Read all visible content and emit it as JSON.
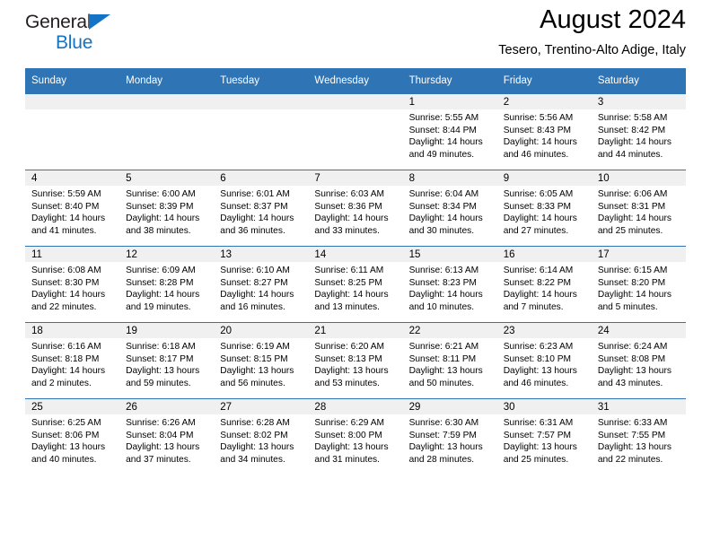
{
  "logo": {
    "name_top": "General",
    "name_bottom": "Blue",
    "triangle_icon": "triangle-icon",
    "accent_color": "#1473c4"
  },
  "header": {
    "month_title": "August 2024",
    "location": "Tesero, Trentino-Alto Adige, Italy"
  },
  "theme": {
    "header_blue": "#2f74b5",
    "daynum_band": "#f0f0f0",
    "text": "#000000"
  },
  "weekday_headers": [
    "Sunday",
    "Monday",
    "Tuesday",
    "Wednesday",
    "Thursday",
    "Friday",
    "Saturday"
  ],
  "weeks": [
    [
      {
        "day": "",
        "sunrise": "",
        "sunset": "",
        "daylight_line1": "",
        "daylight_line2": ""
      },
      {
        "day": "",
        "sunrise": "",
        "sunset": "",
        "daylight_line1": "",
        "daylight_line2": ""
      },
      {
        "day": "",
        "sunrise": "",
        "sunset": "",
        "daylight_line1": "",
        "daylight_line2": ""
      },
      {
        "day": "",
        "sunrise": "",
        "sunset": "",
        "daylight_line1": "",
        "daylight_line2": ""
      },
      {
        "day": "1",
        "sunrise": "Sunrise: 5:55 AM",
        "sunset": "Sunset: 8:44 PM",
        "daylight_line1": "Daylight: 14 hours",
        "daylight_line2": "and 49 minutes."
      },
      {
        "day": "2",
        "sunrise": "Sunrise: 5:56 AM",
        "sunset": "Sunset: 8:43 PM",
        "daylight_line1": "Daylight: 14 hours",
        "daylight_line2": "and 46 minutes."
      },
      {
        "day": "3",
        "sunrise": "Sunrise: 5:58 AM",
        "sunset": "Sunset: 8:42 PM",
        "daylight_line1": "Daylight: 14 hours",
        "daylight_line2": "and 44 minutes."
      }
    ],
    [
      {
        "day": "4",
        "sunrise": "Sunrise: 5:59 AM",
        "sunset": "Sunset: 8:40 PM",
        "daylight_line1": "Daylight: 14 hours",
        "daylight_line2": "and 41 minutes."
      },
      {
        "day": "5",
        "sunrise": "Sunrise: 6:00 AM",
        "sunset": "Sunset: 8:39 PM",
        "daylight_line1": "Daylight: 14 hours",
        "daylight_line2": "and 38 minutes."
      },
      {
        "day": "6",
        "sunrise": "Sunrise: 6:01 AM",
        "sunset": "Sunset: 8:37 PM",
        "daylight_line1": "Daylight: 14 hours",
        "daylight_line2": "and 36 minutes."
      },
      {
        "day": "7",
        "sunrise": "Sunrise: 6:03 AM",
        "sunset": "Sunset: 8:36 PM",
        "daylight_line1": "Daylight: 14 hours",
        "daylight_line2": "and 33 minutes."
      },
      {
        "day": "8",
        "sunrise": "Sunrise: 6:04 AM",
        "sunset": "Sunset: 8:34 PM",
        "daylight_line1": "Daylight: 14 hours",
        "daylight_line2": "and 30 minutes."
      },
      {
        "day": "9",
        "sunrise": "Sunrise: 6:05 AM",
        "sunset": "Sunset: 8:33 PM",
        "daylight_line1": "Daylight: 14 hours",
        "daylight_line2": "and 27 minutes."
      },
      {
        "day": "10",
        "sunrise": "Sunrise: 6:06 AM",
        "sunset": "Sunset: 8:31 PM",
        "daylight_line1": "Daylight: 14 hours",
        "daylight_line2": "and 25 minutes."
      }
    ],
    [
      {
        "day": "11",
        "sunrise": "Sunrise: 6:08 AM",
        "sunset": "Sunset: 8:30 PM",
        "daylight_line1": "Daylight: 14 hours",
        "daylight_line2": "and 22 minutes."
      },
      {
        "day": "12",
        "sunrise": "Sunrise: 6:09 AM",
        "sunset": "Sunset: 8:28 PM",
        "daylight_line1": "Daylight: 14 hours",
        "daylight_line2": "and 19 minutes."
      },
      {
        "day": "13",
        "sunrise": "Sunrise: 6:10 AM",
        "sunset": "Sunset: 8:27 PM",
        "daylight_line1": "Daylight: 14 hours",
        "daylight_line2": "and 16 minutes."
      },
      {
        "day": "14",
        "sunrise": "Sunrise: 6:11 AM",
        "sunset": "Sunset: 8:25 PM",
        "daylight_line1": "Daylight: 14 hours",
        "daylight_line2": "and 13 minutes."
      },
      {
        "day": "15",
        "sunrise": "Sunrise: 6:13 AM",
        "sunset": "Sunset: 8:23 PM",
        "daylight_line1": "Daylight: 14 hours",
        "daylight_line2": "and 10 minutes."
      },
      {
        "day": "16",
        "sunrise": "Sunrise: 6:14 AM",
        "sunset": "Sunset: 8:22 PM",
        "daylight_line1": "Daylight: 14 hours",
        "daylight_line2": "and 7 minutes."
      },
      {
        "day": "17",
        "sunrise": "Sunrise: 6:15 AM",
        "sunset": "Sunset: 8:20 PM",
        "daylight_line1": "Daylight: 14 hours",
        "daylight_line2": "and 5 minutes."
      }
    ],
    [
      {
        "day": "18",
        "sunrise": "Sunrise: 6:16 AM",
        "sunset": "Sunset: 8:18 PM",
        "daylight_line1": "Daylight: 14 hours",
        "daylight_line2": "and 2 minutes."
      },
      {
        "day": "19",
        "sunrise": "Sunrise: 6:18 AM",
        "sunset": "Sunset: 8:17 PM",
        "daylight_line1": "Daylight: 13 hours",
        "daylight_line2": "and 59 minutes."
      },
      {
        "day": "20",
        "sunrise": "Sunrise: 6:19 AM",
        "sunset": "Sunset: 8:15 PM",
        "daylight_line1": "Daylight: 13 hours",
        "daylight_line2": "and 56 minutes."
      },
      {
        "day": "21",
        "sunrise": "Sunrise: 6:20 AM",
        "sunset": "Sunset: 8:13 PM",
        "daylight_line1": "Daylight: 13 hours",
        "daylight_line2": "and 53 minutes."
      },
      {
        "day": "22",
        "sunrise": "Sunrise: 6:21 AM",
        "sunset": "Sunset: 8:11 PM",
        "daylight_line1": "Daylight: 13 hours",
        "daylight_line2": "and 50 minutes."
      },
      {
        "day": "23",
        "sunrise": "Sunrise: 6:23 AM",
        "sunset": "Sunset: 8:10 PM",
        "daylight_line1": "Daylight: 13 hours",
        "daylight_line2": "and 46 minutes."
      },
      {
        "day": "24",
        "sunrise": "Sunrise: 6:24 AM",
        "sunset": "Sunset: 8:08 PM",
        "daylight_line1": "Daylight: 13 hours",
        "daylight_line2": "and 43 minutes."
      }
    ],
    [
      {
        "day": "25",
        "sunrise": "Sunrise: 6:25 AM",
        "sunset": "Sunset: 8:06 PM",
        "daylight_line1": "Daylight: 13 hours",
        "daylight_line2": "and 40 minutes."
      },
      {
        "day": "26",
        "sunrise": "Sunrise: 6:26 AM",
        "sunset": "Sunset: 8:04 PM",
        "daylight_line1": "Daylight: 13 hours",
        "daylight_line2": "and 37 minutes."
      },
      {
        "day": "27",
        "sunrise": "Sunrise: 6:28 AM",
        "sunset": "Sunset: 8:02 PM",
        "daylight_line1": "Daylight: 13 hours",
        "daylight_line2": "and 34 minutes."
      },
      {
        "day": "28",
        "sunrise": "Sunrise: 6:29 AM",
        "sunset": "Sunset: 8:00 PM",
        "daylight_line1": "Daylight: 13 hours",
        "daylight_line2": "and 31 minutes."
      },
      {
        "day": "29",
        "sunrise": "Sunrise: 6:30 AM",
        "sunset": "Sunset: 7:59 PM",
        "daylight_line1": "Daylight: 13 hours",
        "daylight_line2": "and 28 minutes."
      },
      {
        "day": "30",
        "sunrise": "Sunrise: 6:31 AM",
        "sunset": "Sunset: 7:57 PM",
        "daylight_line1": "Daylight: 13 hours",
        "daylight_line2": "and 25 minutes."
      },
      {
        "day": "31",
        "sunrise": "Sunrise: 6:33 AM",
        "sunset": "Sunset: 7:55 PM",
        "daylight_line1": "Daylight: 13 hours",
        "daylight_line2": "and 22 minutes."
      }
    ]
  ]
}
